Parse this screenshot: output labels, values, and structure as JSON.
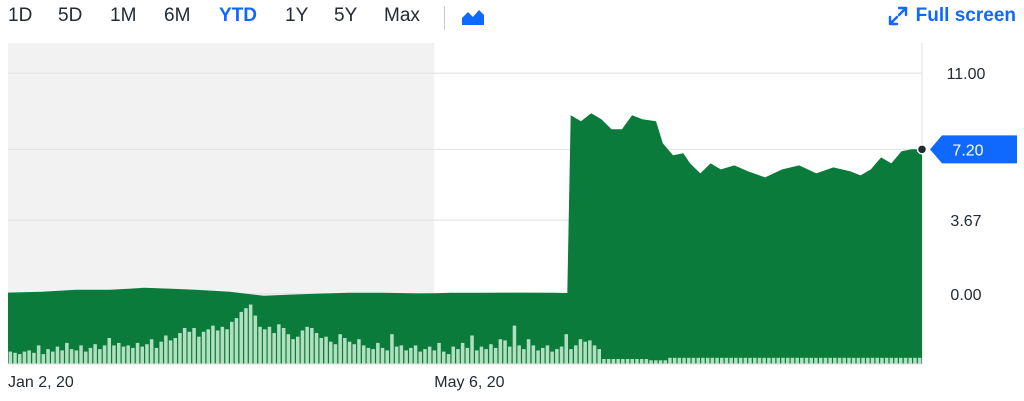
{
  "range_tabs": [
    {
      "label": "1D",
      "active": false
    },
    {
      "label": "5D",
      "active": false
    },
    {
      "label": "1M",
      "active": false
    },
    {
      "label": "6M",
      "active": false
    },
    {
      "label": "YTD",
      "active": true
    },
    {
      "label": "1Y",
      "active": false
    },
    {
      "label": "5Y",
      "active": false
    },
    {
      "label": "Max",
      "active": false
    }
  ],
  "chart_type_icon": "area-chart-icon",
  "fullscreen": {
    "label": "Full screen",
    "icon": "expand-icon"
  },
  "colors": {
    "accent": "#0f69ff",
    "area": "#0b7b3b",
    "volume": "#b2dfc0",
    "shade": "#f2f2f2"
  },
  "chart_data": {
    "type": "area",
    "y_ticks": [
      "11.00",
      "7.20",
      "3.67",
      "0.00"
    ],
    "y_tick_values": [
      11.0,
      7.2,
      3.67,
      0.0
    ],
    "ylim": [
      -3.5,
      12.5
    ],
    "x_tick_labels": [
      "Jan 2, 20",
      "May 6, 20"
    ],
    "current_price": "7.20",
    "current_value": 7.2,
    "price_series": [
      {
        "d": 0,
        "v": 0.06
      },
      {
        "d": 10,
        "v": 0.1
      },
      {
        "d": 20,
        "v": 0.2
      },
      {
        "d": 30,
        "v": 0.2
      },
      {
        "d": 40,
        "v": 0.3
      },
      {
        "d": 48,
        "v": 0.25
      },
      {
        "d": 55,
        "v": 0.2
      },
      {
        "d": 65,
        "v": 0.1
      },
      {
        "d": 75,
        "v": -0.1
      },
      {
        "d": 82,
        "v": -0.05
      },
      {
        "d": 90,
        "v": 0.0
      },
      {
        "d": 100,
        "v": 0.05
      },
      {
        "d": 110,
        "v": 0.05
      },
      {
        "d": 120,
        "v": 0.02
      },
      {
        "d": 125,
        "v": 0.03
      },
      {
        "d": 130,
        "v": 0.05
      },
      {
        "d": 140,
        "v": 0.05
      },
      {
        "d": 150,
        "v": 0.06
      },
      {
        "d": 160,
        "v": 0.05
      },
      {
        "d": 164,
        "v": 0.04
      },
      {
        "d": 165,
        "v": 8.9
      },
      {
        "d": 168,
        "v": 8.6
      },
      {
        "d": 171,
        "v": 9.0
      },
      {
        "d": 174,
        "v": 8.7
      },
      {
        "d": 177,
        "v": 8.2
      },
      {
        "d": 180,
        "v": 8.2
      },
      {
        "d": 183,
        "v": 8.9
      },
      {
        "d": 186,
        "v": 8.7
      },
      {
        "d": 190,
        "v": 8.6
      },
      {
        "d": 192,
        "v": 7.5
      },
      {
        "d": 195,
        "v": 6.9
      },
      {
        "d": 198,
        "v": 7.0
      },
      {
        "d": 200,
        "v": 6.5
      },
      {
        "d": 203,
        "v": 6.0
      },
      {
        "d": 206,
        "v": 6.5
      },
      {
        "d": 209,
        "v": 6.2
      },
      {
        "d": 213,
        "v": 6.4
      },
      {
        "d": 217,
        "v": 6.1
      },
      {
        "d": 222,
        "v": 5.8
      },
      {
        "d": 227,
        "v": 6.2
      },
      {
        "d": 232,
        "v": 6.4
      },
      {
        "d": 237,
        "v": 6.0
      },
      {
        "d": 242,
        "v": 6.3
      },
      {
        "d": 247,
        "v": 6.1
      },
      {
        "d": 250,
        "v": 5.9
      },
      {
        "d": 253,
        "v": 6.2
      },
      {
        "d": 256,
        "v": 6.8
      },
      {
        "d": 259,
        "v": 6.5
      },
      {
        "d": 262,
        "v": 7.1
      },
      {
        "d": 265,
        "v": 7.2
      },
      {
        "d": 268,
        "v": 7.2
      }
    ],
    "shaded_range_days": [
      0,
      125
    ],
    "x_tick_days": [
      0,
      125
    ],
    "days_total": 268,
    "volume": [
      0.2,
      0.18,
      0.16,
      0.2,
      0.22,
      0.18,
      0.3,
      0.16,
      0.24,
      0.2,
      0.28,
      0.22,
      0.34,
      0.24,
      0.22,
      0.3,
      0.2,
      0.26,
      0.32,
      0.24,
      0.3,
      0.42,
      0.3,
      0.34,
      0.28,
      0.3,
      0.26,
      0.34,
      0.28,
      0.32,
      0.4,
      0.26,
      0.36,
      0.46,
      0.38,
      0.42,
      0.5,
      0.58,
      0.52,
      0.58,
      0.44,
      0.52,
      0.56,
      0.62,
      0.54,
      0.6,
      0.56,
      0.68,
      0.74,
      0.84,
      0.9,
      0.96,
      0.78,
      0.6,
      0.56,
      0.6,
      0.5,
      0.64,
      0.58,
      0.48,
      0.4,
      0.44,
      0.54,
      0.6,
      0.58,
      0.5,
      0.42,
      0.44,
      0.36,
      0.32,
      0.48,
      0.42,
      0.36,
      0.32,
      0.4,
      0.3,
      0.26,
      0.24,
      0.34,
      0.26,
      0.22,
      0.48,
      0.28,
      0.3,
      0.22,
      0.26,
      0.3,
      0.2,
      0.24,
      0.28,
      0.22,
      0.34,
      0.2,
      0.16,
      0.28,
      0.24,
      0.34,
      0.26,
      0.46,
      0.22,
      0.28,
      0.24,
      0.32,
      0.26,
      0.4,
      0.38,
      0.28,
      0.62,
      0.3,
      0.24,
      0.4,
      0.3,
      0.22,
      0.26,
      0.3,
      0.2,
      0.24,
      0.28,
      0.48,
      0.24,
      0.3,
      0.4,
      0.36,
      0.38,
      0.3,
      0.24,
      0.08,
      0.08,
      0.08,
      0.08,
      0.08,
      0.08,
      0.08,
      0.08,
      0.08,
      0.08,
      0.06,
      0.06,
      0.06,
      0.06,
      0.1,
      0.1,
      0.1,
      0.1,
      0.1,
      0.1,
      0.1,
      0.1,
      0.1,
      0.1,
      0.1,
      0.1,
      0.1,
      0.1,
      0.1,
      0.1,
      0.1,
      0.1,
      0.1,
      0.1,
      0.1,
      0.1,
      0.1,
      0.1,
      0.1,
      0.1,
      0.1,
      0.1,
      0.1,
      0.1,
      0.1,
      0.1,
      0.1,
      0.1,
      0.1,
      0.1,
      0.1,
      0.1,
      0.1,
      0.1,
      0.1,
      0.1,
      0.1,
      0.1,
      0.1,
      0.1,
      0.1,
      0.1,
      0.1,
      0.1,
      0.1,
      0.1,
      0.1,
      0.1
    ],
    "grid": true,
    "legend": "none"
  }
}
